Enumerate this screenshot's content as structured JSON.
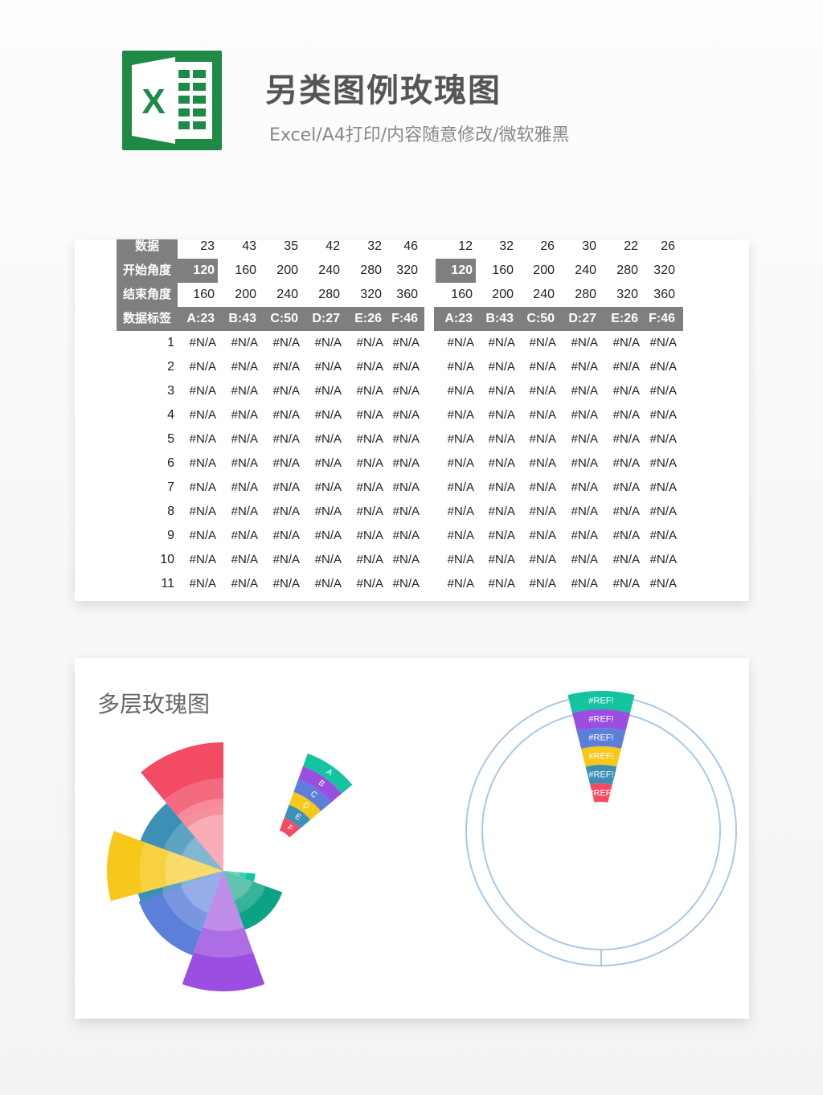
{
  "header": {
    "title": "另类图例玫瑰图",
    "subtitle": "Excel/A4打印/内容随意修改/微软雅黑",
    "logo_letter": "X"
  },
  "table": {
    "row_labels": [
      "数据",
      "开始角度",
      "结束角度",
      "数据标签"
    ],
    "left": {
      "data": [
        "23",
        "43",
        "35",
        "42",
        "32",
        "46"
      ],
      "start": [
        "120",
        "160",
        "200",
        "240",
        "280",
        "320"
      ],
      "end": [
        "160",
        "200",
        "240",
        "280",
        "320",
        "360"
      ],
      "labels": [
        "A:23",
        "B:43",
        "C:50",
        "D:27",
        "E:26",
        "F:46"
      ]
    },
    "right": {
      "data": [
        "12",
        "32",
        "26",
        "30",
        "22",
        "26"
      ],
      "start": [
        "120",
        "160",
        "200",
        "240",
        "280",
        "320"
      ],
      "end": [
        "160",
        "200",
        "240",
        "280",
        "320",
        "360"
      ],
      "labels": [
        "A:23",
        "B:43",
        "C:50",
        "D:27",
        "E:26",
        "F:46"
      ]
    },
    "index_rows": [
      "1",
      "2",
      "3",
      "4",
      "5",
      "6",
      "7",
      "8",
      "9",
      "10",
      "11"
    ],
    "na_value": "#N/A"
  },
  "chart": {
    "title": "多层玫瑰图",
    "legend_letters": [
      "A",
      "B",
      "C",
      "D",
      "E",
      "F"
    ],
    "ref_label": "#REF!",
    "colors": {
      "red": "#f24b63",
      "teal": "#14c4a0",
      "purple": "#9b4fe0",
      "blue": "#5c7fd9",
      "yellow": "#f7c719",
      "steel": "#3c8fb5",
      "pink": "#f7919e",
      "ring": "#a9c8e6"
    }
  }
}
